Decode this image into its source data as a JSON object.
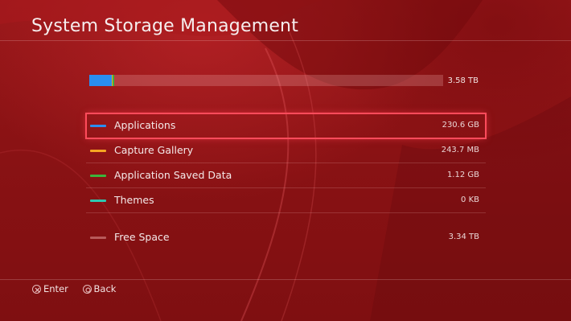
{
  "header": {
    "title": "System Storage Management"
  },
  "storage": {
    "total": "3.58 TB",
    "usage_fractions": {
      "applications": 0.063,
      "capture_gallery": 0.0001,
      "saved_data": 0.0003
    }
  },
  "categories": [
    {
      "label": "Applications",
      "value": "230.6 GB",
      "color": "#2a8ef0",
      "focused": true
    },
    {
      "label": "Capture Gallery",
      "value": "243.7 MB",
      "color": "#f5a623",
      "focused": false
    },
    {
      "label": "Application Saved Data",
      "value": "1.12 GB",
      "color": "#3cb43c",
      "focused": false
    },
    {
      "label": "Themes",
      "value": "0 KB",
      "color": "#2ec8b0",
      "focused": false
    }
  ],
  "free": {
    "label": "Free Space",
    "value": "3.34 TB",
    "color": "#b85a5a"
  },
  "footer": {
    "enter": {
      "icon": "cross-button-icon",
      "label": "Enter"
    },
    "back": {
      "icon": "circle-button-icon",
      "label": "Back"
    }
  },
  "theme": {
    "accent": "#ff4b5b",
    "background": "#8e1416"
  }
}
